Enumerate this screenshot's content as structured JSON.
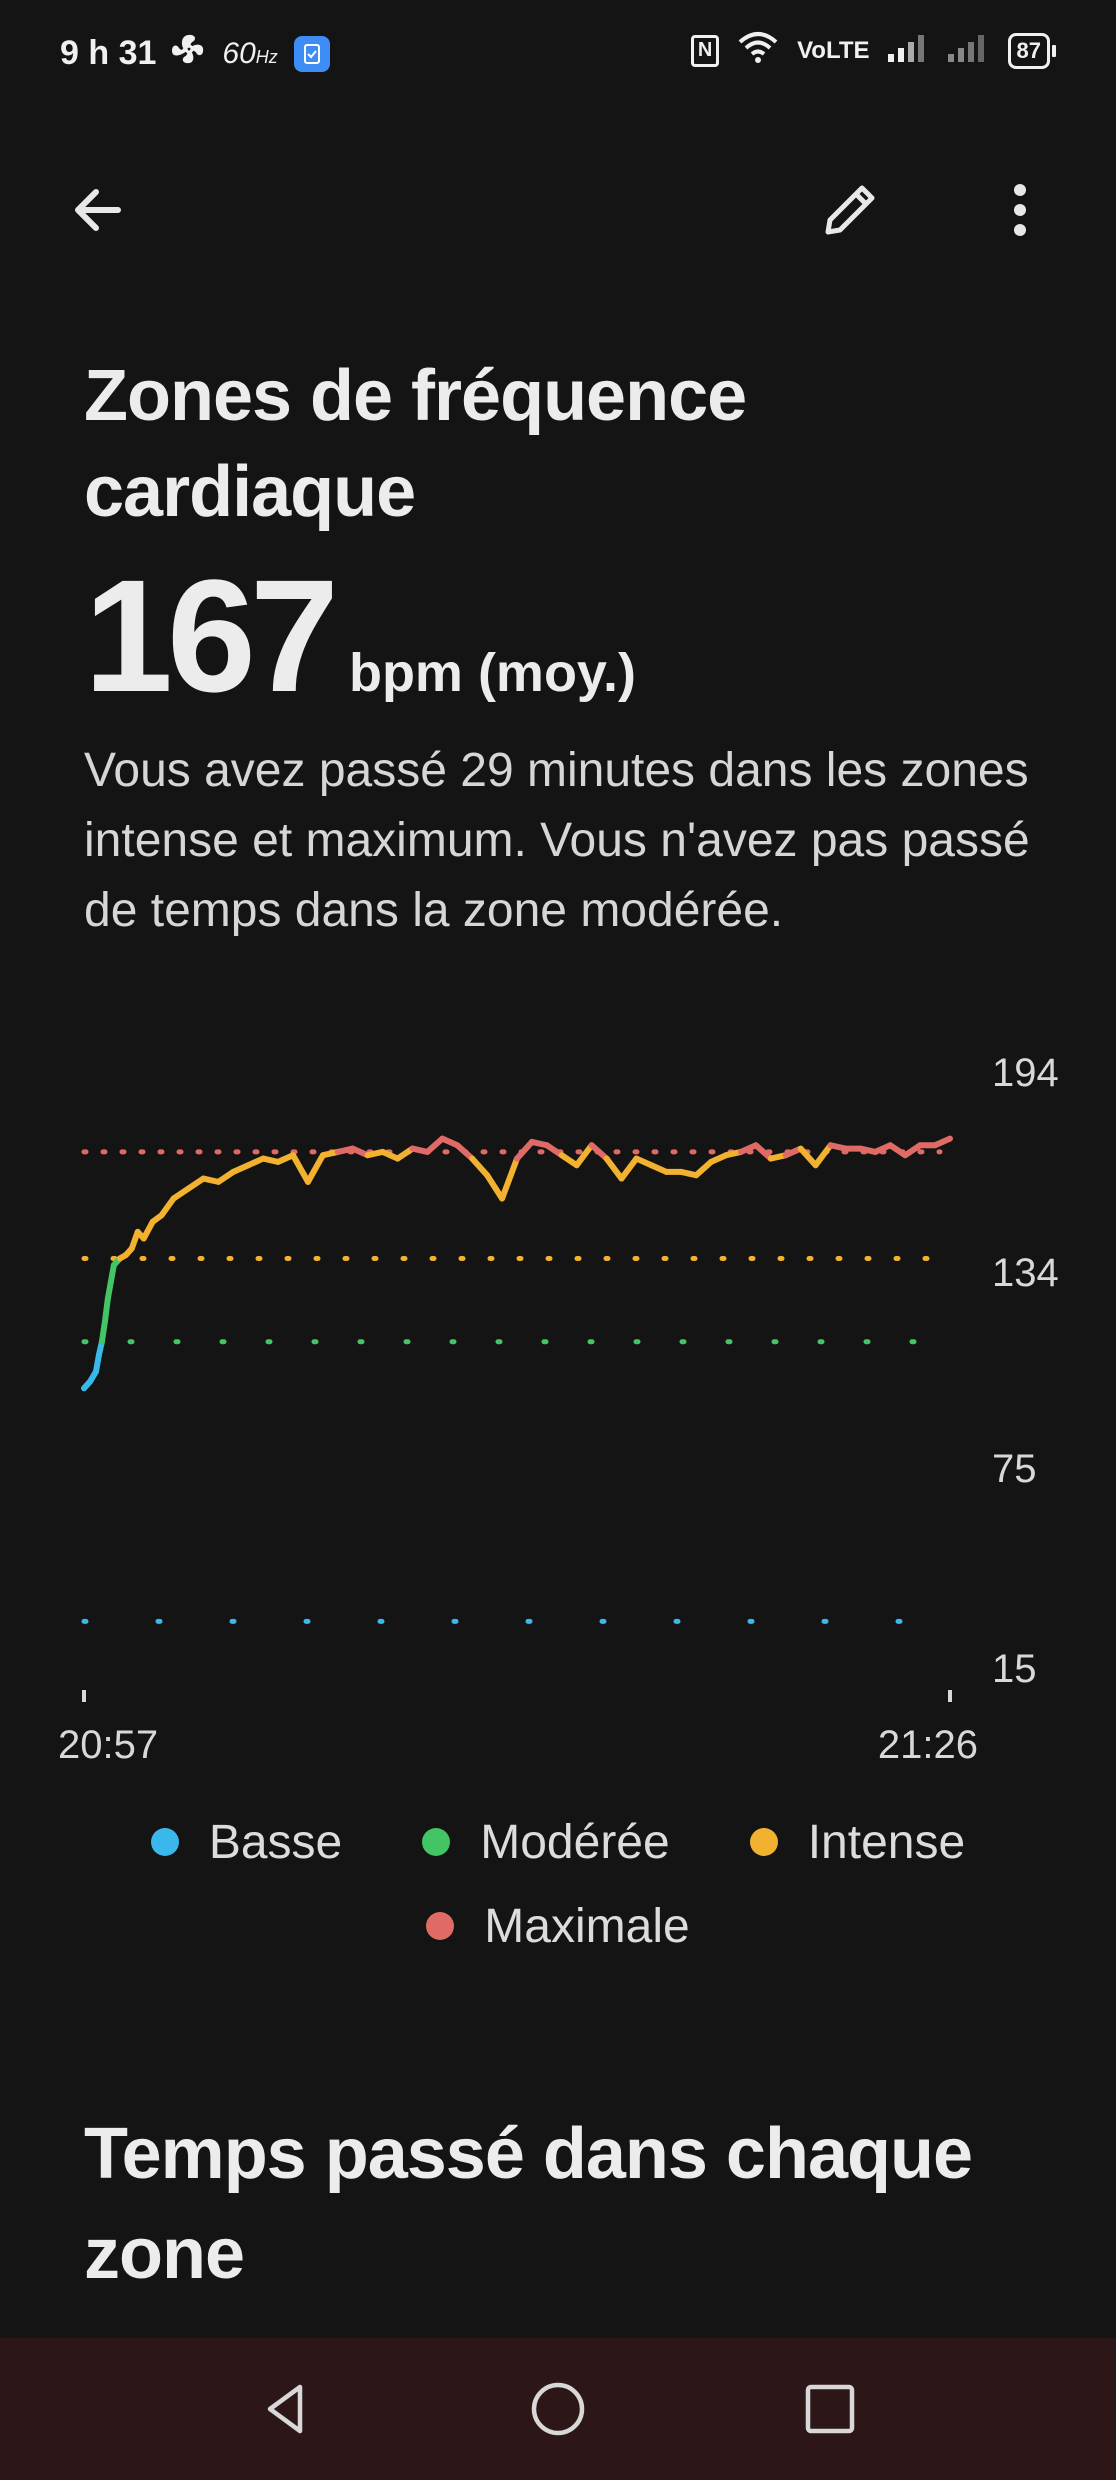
{
  "status_bar": {
    "time": "9 h 31",
    "refresh_rate": "60",
    "refresh_unit": "Hz",
    "network": "VoLTE",
    "battery": "87",
    "icons": [
      "fan-icon",
      "app-notification-icon",
      "nfc-icon",
      "wifi-icon",
      "signal-icon",
      "signal-icon",
      "battery-icon"
    ]
  },
  "toolbar": {
    "back_icon": "arrow-back-icon",
    "edit_icon": "pencil-icon",
    "more_icon": "more-vertical-icon"
  },
  "header": {
    "title": "Zones de fréquence cardiaque",
    "avg_value": "167",
    "avg_unit": "bpm (moy.)",
    "summary": "Vous avez passé 29 minutes dans les zones intense et maximum. Vous n'avez pas passé de temps dans la zone modérée."
  },
  "colors": {
    "basse": "#3ab8ec",
    "moderee": "#43c465",
    "intense": "#f2b12e",
    "maximale": "#e06b66",
    "background": "#141414",
    "nav_bar": "#2c1617"
  },
  "legend": [
    {
      "label": "Basse",
      "color": "#3ab8ec"
    },
    {
      "label": "Modérée",
      "color": "#43c465"
    },
    {
      "label": "Intense",
      "color": "#f2b12e"
    },
    {
      "label": "Maximale",
      "color": "#e06b66"
    }
  ],
  "chart_data": {
    "type": "line",
    "x_unit": "minutes",
    "x_start_label": "20:57",
    "x_end_label": "21:26",
    "ylim": [
      15,
      194
    ],
    "y_ticks": [
      194,
      134,
      75,
      15
    ],
    "x_ticks": [
      "20:57",
      "21:26"
    ],
    "zone_thresholds": [
      {
        "zone": "Maximale",
        "value": 170,
        "color": "#e06b66"
      },
      {
        "zone": "Intense",
        "value": 138,
        "color": "#f2b12e"
      },
      {
        "zone": "Modérée",
        "value": 113,
        "color": "#43c465"
      },
      {
        "zone": "Basse",
        "value": 29,
        "color": "#3ab8ec"
      }
    ],
    "series": [
      {
        "x": [
          0,
          0.2,
          0.4,
          0.5,
          0.6,
          0.7,
          0.8,
          0.9,
          1.0,
          1.2,
          1.4,
          1.6,
          1.8,
          2.0,
          2.3,
          2.6,
          3.0,
          3.5,
          4.0,
          4.5,
          5.0,
          5.5,
          6.0,
          6.5,
          7.0,
          7.5,
          8.0,
          8.5,
          9.0,
          9.5,
          10.0,
          10.5,
          11.0,
          11.5,
          12.0,
          12.5,
          13.0,
          13.5,
          14.0,
          14.5,
          15.0,
          15.5,
          16.0,
          16.5,
          17.0,
          17.5,
          18.0,
          18.5,
          19.0,
          19.5,
          20.0,
          20.5,
          21.0,
          21.5,
          22.0,
          22.5,
          23.0,
          23.5,
          24.0,
          24.5,
          25.0,
          25.5,
          26.0,
          26.5,
          27.0,
          27.5,
          28.0,
          28.5,
          29.0
        ],
        "y": [
          99,
          101,
          104,
          109,
          113,
          119,
          126,
          131,
          136,
          138,
          139,
          141,
          146,
          144,
          149,
          151,
          156,
          159,
          162,
          161,
          164,
          166,
          168,
          167,
          169,
          161,
          169,
          170,
          171,
          169,
          170,
          168,
          171,
          170,
          174,
          172,
          168,
          163,
          156,
          168,
          173,
          172,
          169,
          166,
          172,
          168,
          162,
          168,
          166,
          164,
          164,
          163,
          167,
          169,
          170,
          172,
          168,
          169,
          171,
          166,
          172,
          171,
          171,
          170,
          172,
          169,
          172,
          172,
          174
        ]
      }
    ]
  },
  "section": {
    "title": "Temps passé dans chaque zone"
  },
  "nav": {
    "back_icon": "triangle-back-icon",
    "home_icon": "circle-home-icon",
    "recents_icon": "square-recents-icon"
  }
}
